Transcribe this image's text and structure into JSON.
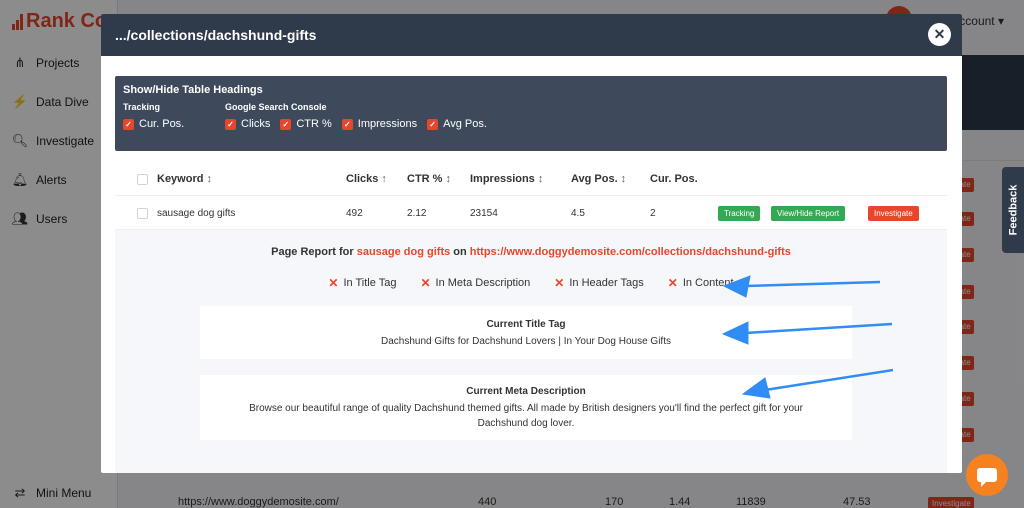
{
  "app": {
    "logo_text": "Rank Co",
    "account_label": "Account ▾",
    "sidebar": [
      {
        "label": "Projects",
        "icon": "projects-icon"
      },
      {
        "label": "Data Dive",
        "icon": "bolt-icon"
      },
      {
        "label": "Investigate",
        "icon": "search-icon"
      },
      {
        "label": "Alerts",
        "icon": "bell-icon"
      },
      {
        "label": "Users",
        "icon": "users-icon"
      }
    ],
    "mini_menu": "Mini Menu",
    "feedback": "Feedback",
    "bg_badge": "Investigate",
    "bg_row": {
      "url": "https://www.doggydemosite.com/",
      "clicks": "440",
      "v1": "170",
      "v2": "1.44",
      "v3": "11839",
      "v4": "47.53"
    }
  },
  "modal": {
    "title": ".../collections/dachshund-gifts",
    "headings": {
      "title": "Show/Hide Table Headings",
      "tracking_label": "Tracking",
      "gsc_label": "Google Search Console",
      "tracking_checks": [
        "Cur. Pos."
      ],
      "gsc_checks": [
        "Clicks",
        "CTR %",
        "Impressions",
        "Avg Pos."
      ]
    },
    "table": {
      "columns": {
        "keyword": "Keyword",
        "clicks": "Clicks",
        "ctr": "CTR %",
        "impressions": "Impressions",
        "avg_pos": "Avg Pos.",
        "cur_pos": "Cur. Pos."
      },
      "row": {
        "keyword": "sausage dog gifts",
        "clicks": "492",
        "ctr": "2.12",
        "impressions": "23154",
        "avg_pos": "4.5",
        "cur_pos": "2"
      },
      "buttons": {
        "tracking": "Tracking",
        "view_hide": "View/Hide Report",
        "investigate": "Investigate"
      }
    },
    "report": {
      "prefix": "Page Report for ",
      "keyword": "sausage dog gifts",
      "on": " on ",
      "url": "https://www.doggydemosite.com/collections/dachshund-gifts",
      "flags": [
        "In Title Tag",
        "In Meta Description",
        "In Header Tags",
        "In Content"
      ],
      "title_tag_heading": "Current Title Tag",
      "title_tag_value": "Dachshund Gifts for Dachshund Lovers | In Your Dog House Gifts",
      "meta_heading": "Current Meta Description",
      "meta_value": "Browse our beautiful range of quality Dachshund themed gifts. All made by British designers you'll find the perfect gift for your Dachshund dog lover."
    }
  },
  "colors": {
    "accent": "#e8452c",
    "header": "#2f3a4b",
    "green": "#34a853",
    "arrow": "#2f8df5"
  }
}
